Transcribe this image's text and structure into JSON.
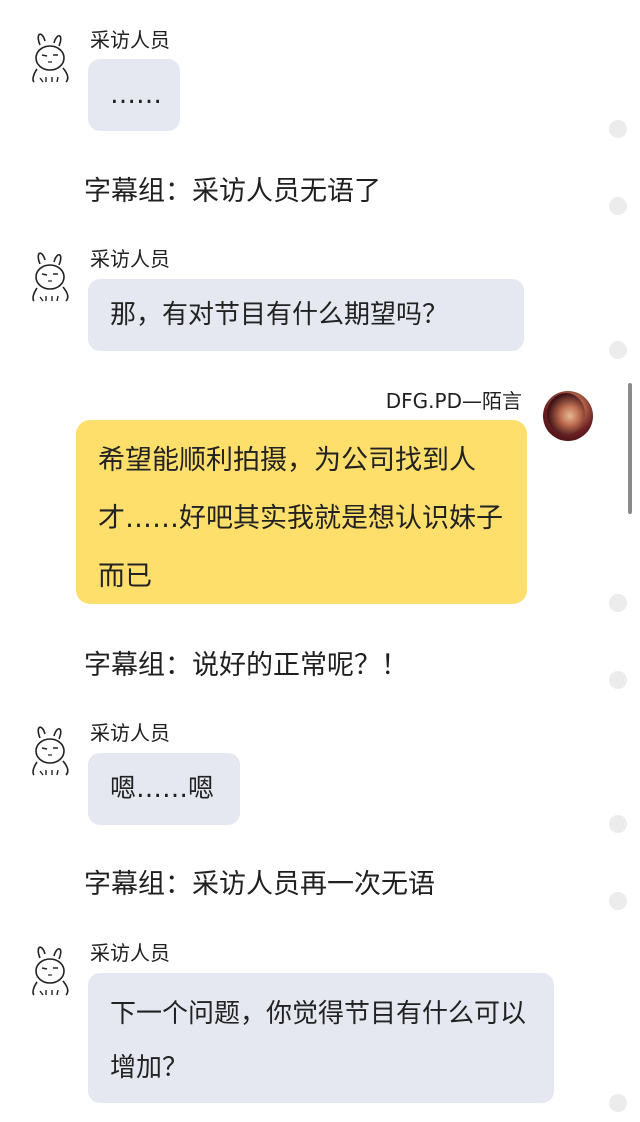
{
  "messages": [
    {
      "type": "left",
      "sender": "采访人员",
      "text": "……",
      "avatar": "rabbit-face-icon"
    },
    {
      "type": "caption",
      "text": "字幕组：采访人员无语了"
    },
    {
      "type": "left",
      "sender": "采访人员",
      "text": "那，有对节目有什么期望吗？",
      "avatar": "rabbit-face-icon"
    },
    {
      "type": "right",
      "sender": "DFG.PD—陌言",
      "text": "希望能顺利拍摄，为公司找到人才……好吧其实我就是想认识妹子而已",
      "avatar": "user-avatar"
    },
    {
      "type": "caption",
      "text": "字幕组：说好的正常呢？！"
    },
    {
      "type": "left",
      "sender": "采访人员",
      "text": "嗯……嗯",
      "avatar": "rabbit-face-icon"
    },
    {
      "type": "caption",
      "text": "字幕组：采访人员再一次无语"
    },
    {
      "type": "left",
      "sender": "采访人员",
      "text": "下一个问题，你觉得节目有什么可以增加？",
      "avatar": "rabbit-face-icon"
    }
  ],
  "colors": {
    "left_bubble": "#e5e8f0",
    "right_bubble": "#ffdf6c",
    "background": "#ffffff"
  }
}
